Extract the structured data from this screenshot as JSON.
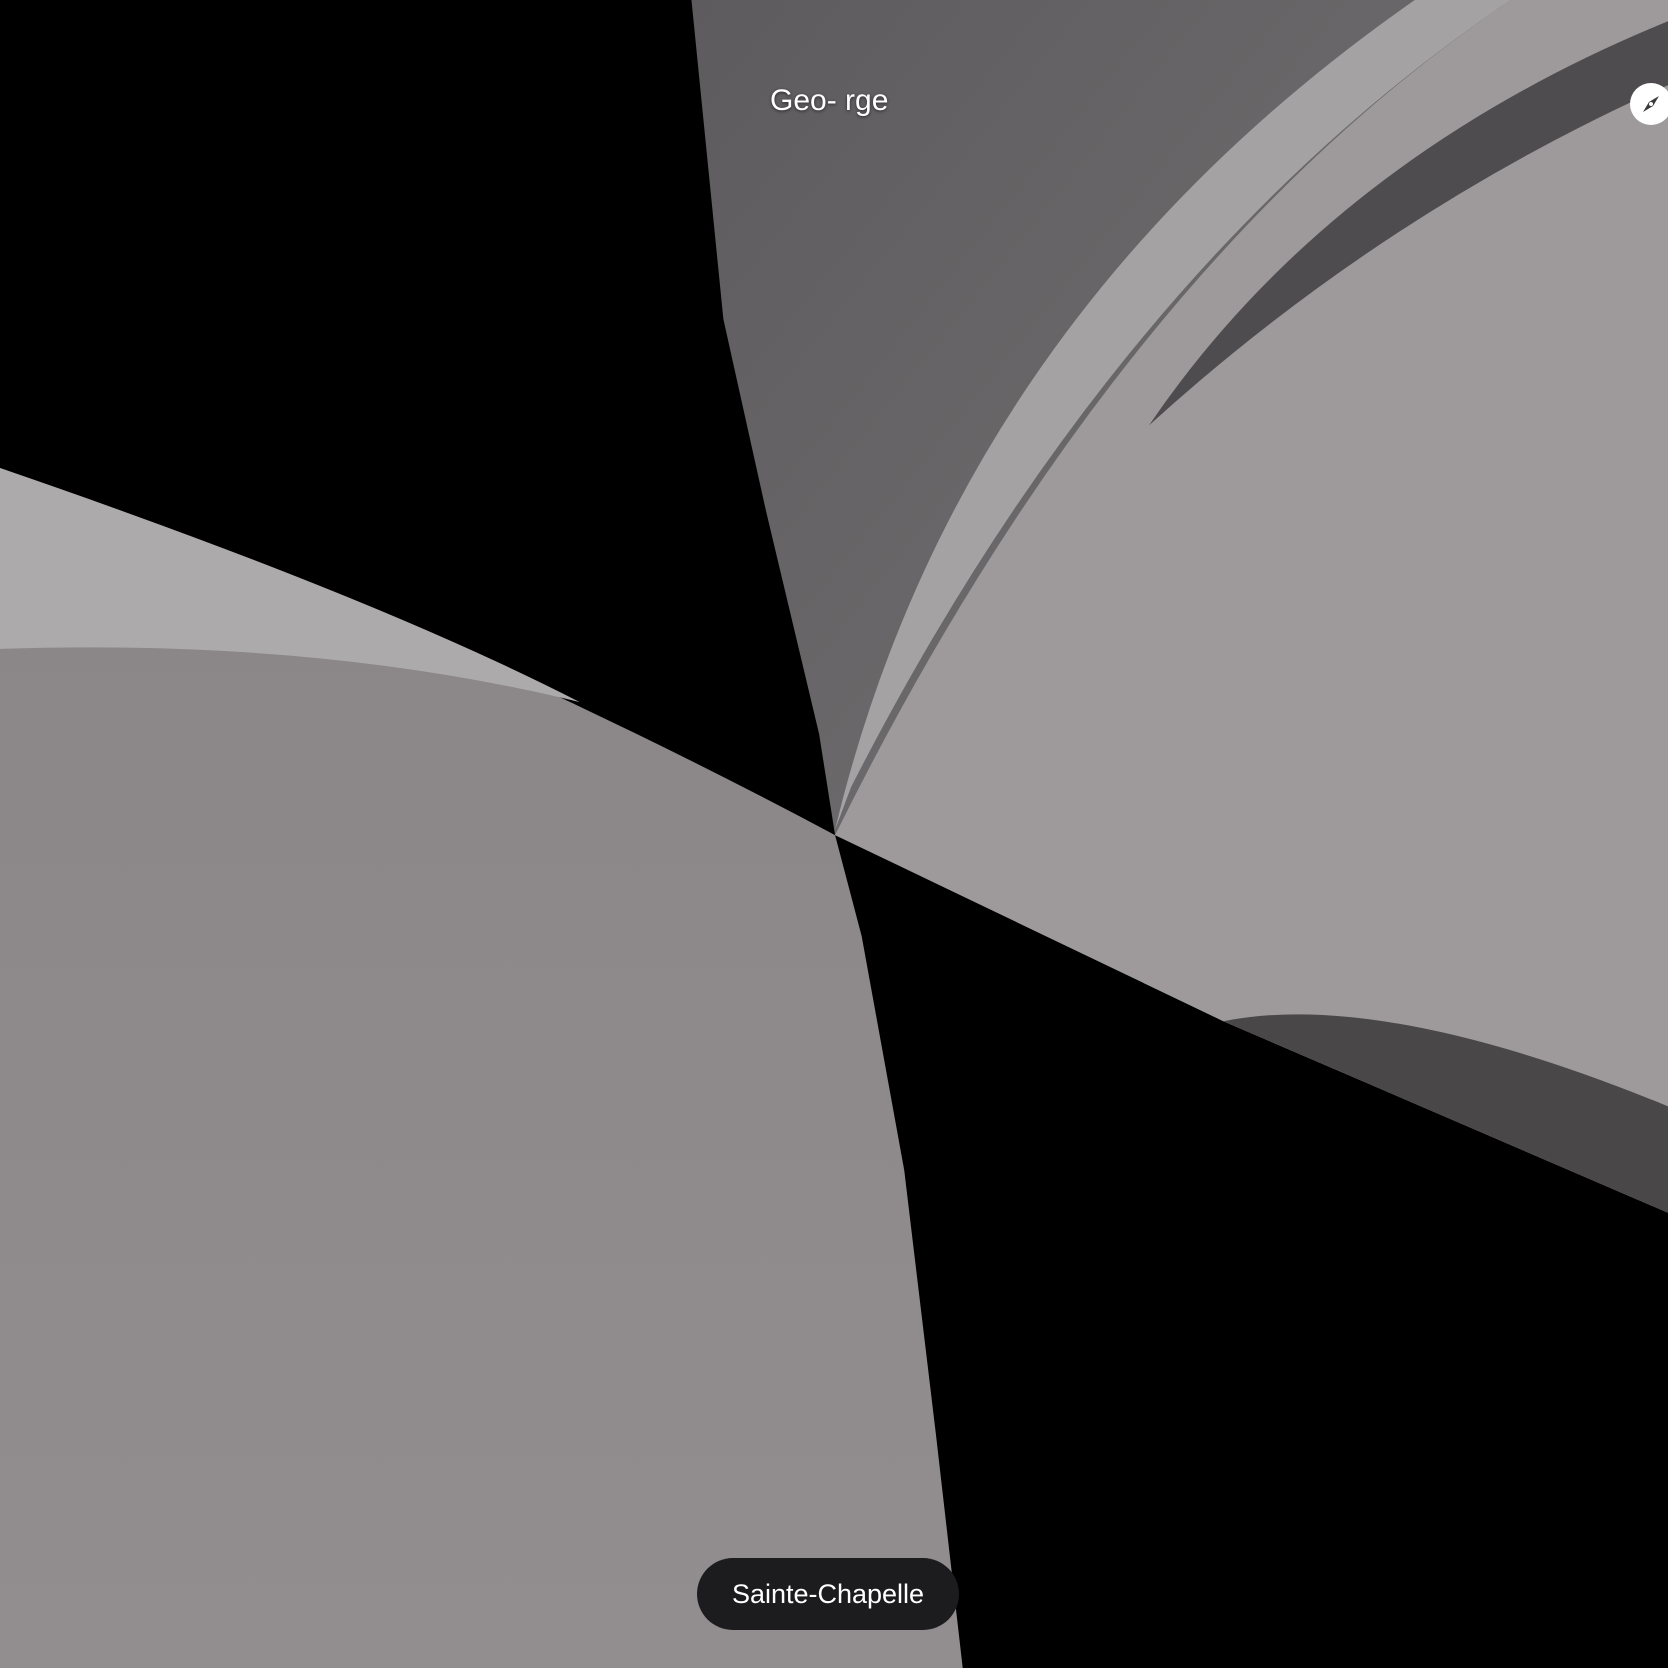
{
  "street_label": "Geo- rge",
  "place_button": {
    "label": "Sainte-Chapelle"
  },
  "icons": {
    "compass": "compass-icon"
  },
  "colors": {
    "background": "#000000",
    "pill": "#1c1c1e",
    "road": "#8f8b8d",
    "curb": "#a9a6a7"
  }
}
